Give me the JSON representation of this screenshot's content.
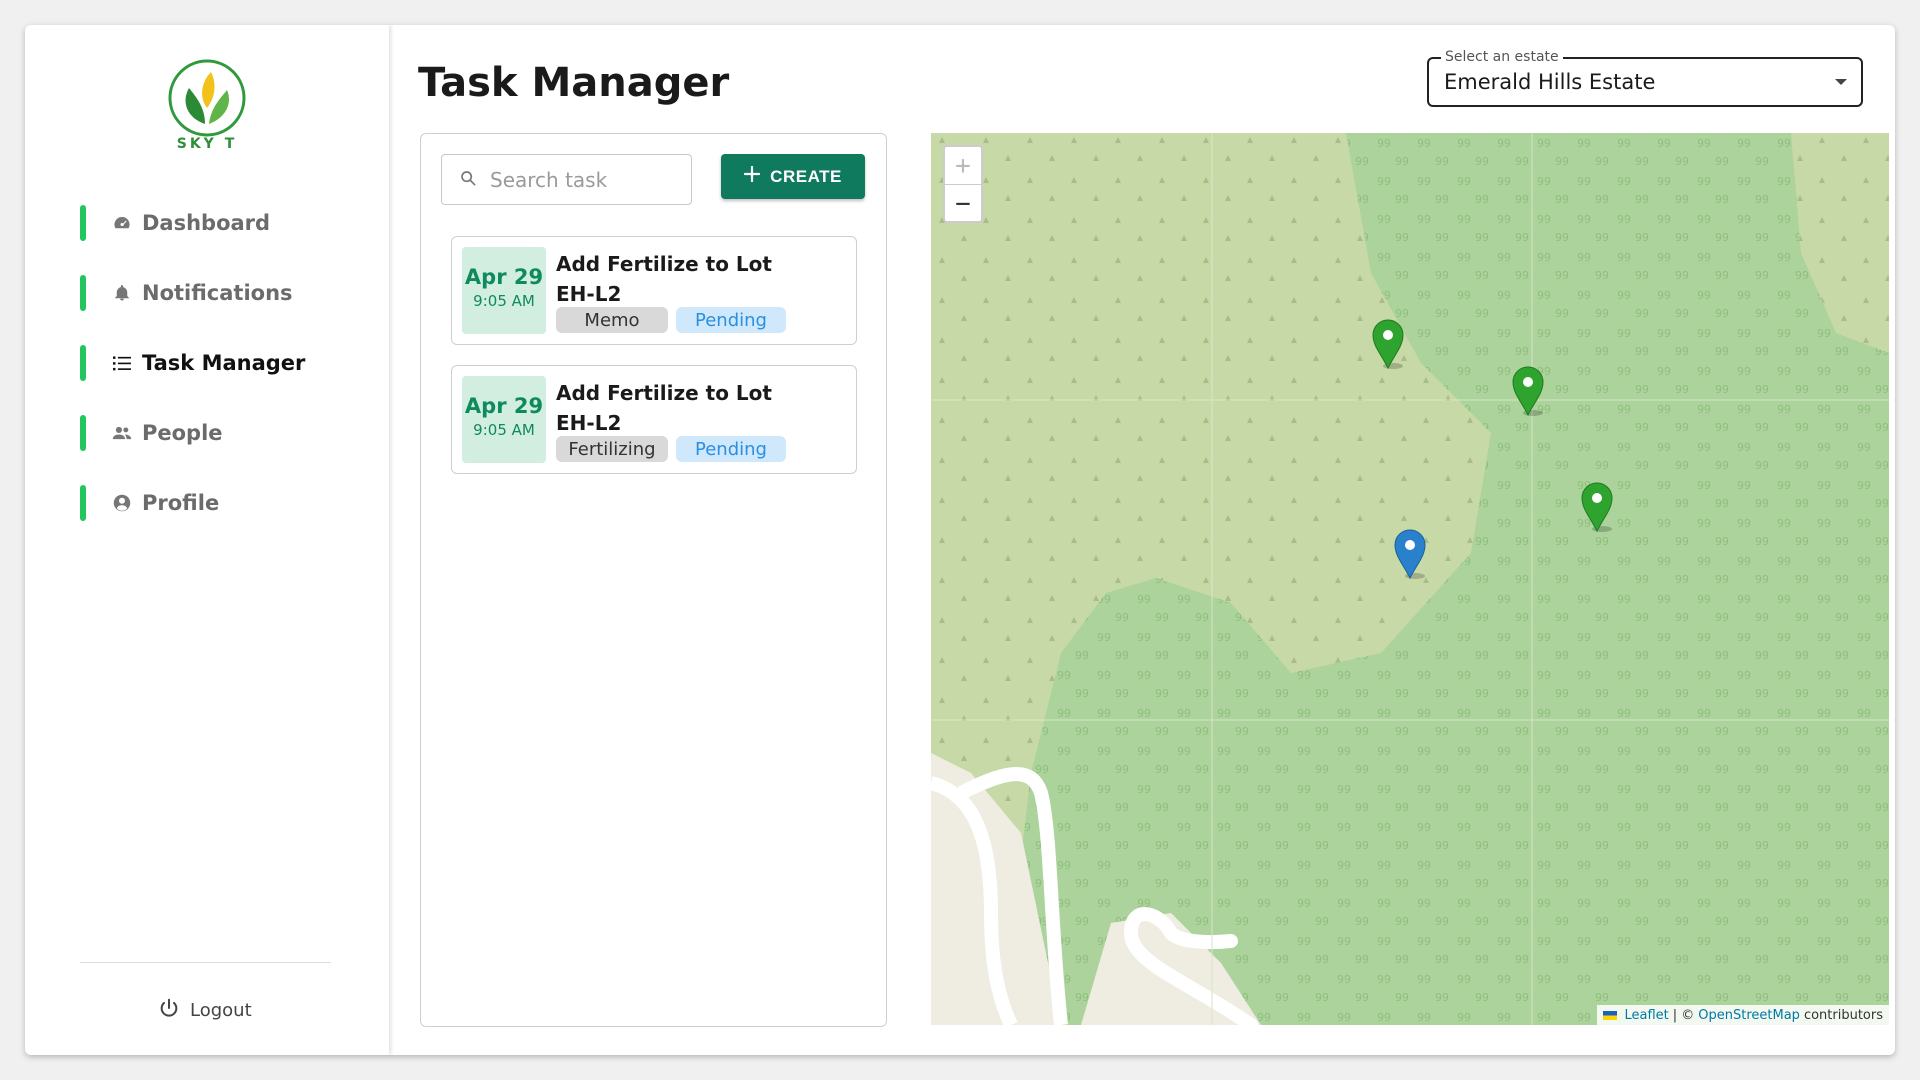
{
  "brand": {
    "name": "SKY T"
  },
  "sidebar": {
    "items": [
      {
        "label": "Dashboard",
        "icon": "dashboard-icon"
      },
      {
        "label": "Notifications",
        "icon": "bell-icon"
      },
      {
        "label": "Task Manager",
        "icon": "task-list-icon",
        "active": true
      },
      {
        "label": "People",
        "icon": "people-icon"
      },
      {
        "label": "Profile",
        "icon": "profile-icon"
      }
    ],
    "logout_label": "Logout"
  },
  "header": {
    "title": "Task Manager"
  },
  "estate_select": {
    "legend": "Select an estate",
    "value": "Emerald Hills Estate"
  },
  "tasks": {
    "search_placeholder": "Search task",
    "create_label": "CREATE",
    "items": [
      {
        "date": "Apr 29",
        "time": "9:05 AM",
        "title": "Add Fertilize to Lot EH-L2",
        "type": "Memo",
        "status": "Pending"
      },
      {
        "date": "Apr 29",
        "time": "9:05 AM",
        "title": "Add Fertilize to Lot EH-L2",
        "type": "Fertilizing",
        "status": "Pending"
      }
    ]
  },
  "map": {
    "zoom_in": "+",
    "zoom_out": "−",
    "attribution": {
      "leaflet": "Leaflet",
      "separator": "| ©",
      "osm": "OpenStreetMap",
      "suffix": "contributors"
    },
    "markers": [
      {
        "color": "green"
      },
      {
        "color": "green"
      },
      {
        "color": "green"
      },
      {
        "color": "blue",
        "selected": true
      }
    ]
  },
  "colors": {
    "accent": "#0f7a5e",
    "nav_indicator": "#22c55e",
    "status_pending_bg": "#cfe8fb",
    "status_pending_text": "#2a8fe0",
    "date_bg": "#d2eee0",
    "marker_green": "#2ea32e",
    "marker_blue": "#2a81cb"
  }
}
